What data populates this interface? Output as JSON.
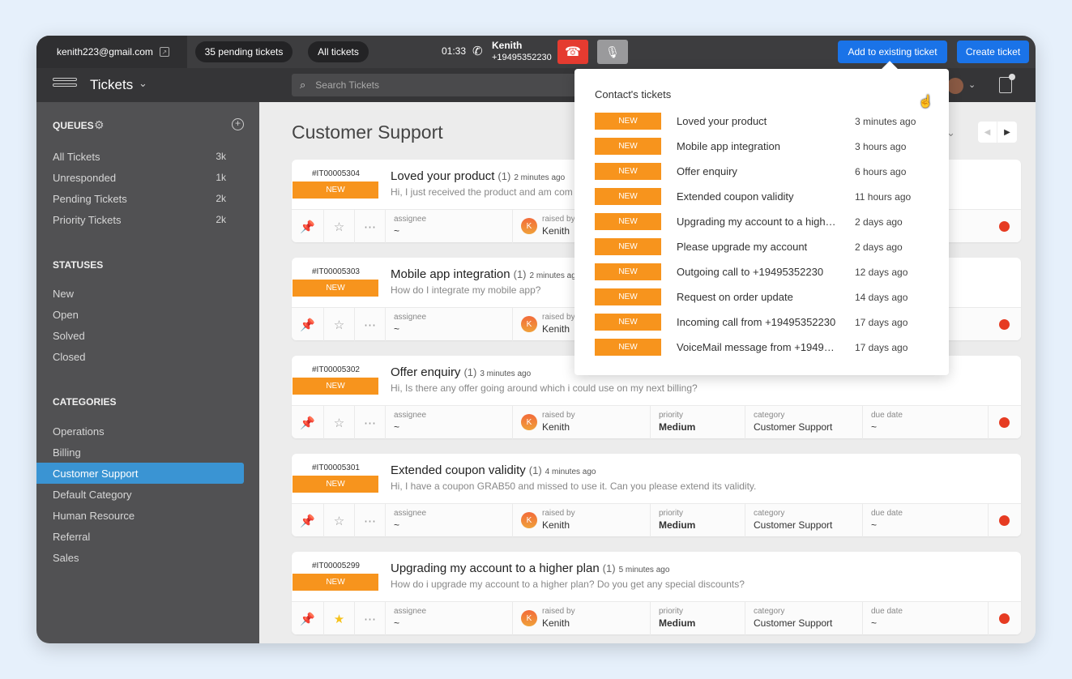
{
  "topbar": {
    "email": "kenith223@gmail.com",
    "pending_label": "35 pending tickets",
    "all_label": "All tickets",
    "call_time": "01:33",
    "caller_name": "Kenith",
    "caller_number": "+19495352230",
    "add_existing_label": "Add to existing ticket",
    "create_label": "Create ticket"
  },
  "header": {
    "app_name": "Tickets",
    "search_placeholder": "Search Tickets"
  },
  "sidebar": {
    "queues_heading": "QUEUES",
    "queues": [
      {
        "label": "All Tickets",
        "count": "3k"
      },
      {
        "label": "Unresponded",
        "count": "1k"
      },
      {
        "label": "Pending Tickets",
        "count": "2k"
      },
      {
        "label": "Priority Tickets",
        "count": "2k"
      }
    ],
    "statuses_heading": "STATUSES",
    "statuses": [
      "New",
      "Open",
      "Solved",
      "Closed"
    ],
    "categories_heading": "CATEGORIES",
    "categories": [
      "Operations",
      "Billing",
      "Customer Support",
      "Default Category",
      "Human Resource",
      "Referral",
      "Sales"
    ],
    "active_category": "Customer Support"
  },
  "main": {
    "title": "Customer Support",
    "pager_fragment": ")"
  },
  "tickets": [
    {
      "id": "#IT00005304",
      "status": "NEW",
      "title": "Loved your product",
      "count": "(1)",
      "time": "2 minutes ago",
      "desc": "Hi, I just received the product and am com",
      "assignee_label": "assignee",
      "assignee": "~",
      "raised_label": "raised by",
      "raised_by": "Kenith",
      "avatar_initial": "K",
      "priority_label": "",
      "priority": "",
      "category_label": "",
      "category": "",
      "due_label": "",
      "due": "",
      "starred": false
    },
    {
      "id": "#IT00005303",
      "status": "NEW",
      "title": "Mobile app integration",
      "count": "(1)",
      "time": "2 minutes ago",
      "desc": "How do I integrate my mobile app?",
      "assignee_label": "assignee",
      "assignee": "~",
      "raised_label": "raised by",
      "raised_by": "Kenith",
      "avatar_initial": "K",
      "priority_label": "",
      "priority": "",
      "category_label": "",
      "category": "",
      "due_label": "",
      "due": "",
      "starred": false
    },
    {
      "id": "#IT00005302",
      "status": "NEW",
      "title": "Offer enquiry",
      "count": "(1)",
      "time": "3 minutes ago",
      "desc": "Hi, Is there any offer going around which i could use on my next billing?",
      "assignee_label": "assignee",
      "assignee": "~",
      "raised_label": "raised by",
      "raised_by": "Kenith",
      "avatar_initial": "K",
      "priority_label": "priority",
      "priority": "Medium",
      "category_label": "category",
      "category": "Customer Support",
      "due_label": "due date",
      "due": "~",
      "starred": false
    },
    {
      "id": "#IT00005301",
      "status": "NEW",
      "title": "Extended coupon validity",
      "count": "(1)",
      "time": "4 minutes ago",
      "desc": "Hi, I have a coupon GRAB50 and missed to use it. Can you please extend its validity.",
      "assignee_label": "assignee",
      "assignee": "~",
      "raised_label": "raised by",
      "raised_by": "Kenith",
      "avatar_initial": "K",
      "priority_label": "priority",
      "priority": "Medium",
      "category_label": "category",
      "category": "Customer Support",
      "due_label": "due date",
      "due": "~",
      "starred": false
    },
    {
      "id": "#IT00005299",
      "status": "NEW",
      "title": "Upgrading my account to a higher plan",
      "count": "(1)",
      "time": "5 minutes ago",
      "desc": "How do i upgrade my account to a higher plan? Do you get any special discounts?",
      "assignee_label": "assignee",
      "assignee": "~",
      "raised_label": "raised by",
      "raised_by": "Kenith",
      "avatar_initial": "K",
      "priority_label": "priority",
      "priority": "Medium",
      "category_label": "category",
      "category": "Customer Support",
      "due_label": "due date",
      "due": "~",
      "starred": true
    }
  ],
  "popup": {
    "title": "Contact's tickets",
    "rows": [
      {
        "status": "NEW",
        "title": "Loved your product",
        "time": "3 minutes ago"
      },
      {
        "status": "NEW",
        "title": "Mobile app integration",
        "time": "3 hours ago"
      },
      {
        "status": "NEW",
        "title": "Offer enquiry",
        "time": "6 hours ago"
      },
      {
        "status": "NEW",
        "title": "Extended coupon validity",
        "time": "11 hours ago"
      },
      {
        "status": "NEW",
        "title": "Upgrading my account to a high…",
        "time": "2 days ago"
      },
      {
        "status": "NEW",
        "title": "Please upgrade my account",
        "time": "2 days ago"
      },
      {
        "status": "NEW",
        "title": "Outgoing call to +19495352230",
        "time": "12 days ago"
      },
      {
        "status": "NEW",
        "title": "Request on order update",
        "time": "14 days ago"
      },
      {
        "status": "NEW",
        "title": "Incoming call from +19495352230",
        "time": "17 days ago"
      },
      {
        "status": "NEW",
        "title": "VoiceMail message from +19495…",
        "time": "17 days ago"
      }
    ]
  },
  "colors": {
    "accent_blue": "#1a73e8",
    "status_orange": "#f7941d",
    "active_sidebar": "#3a94d3",
    "hangup_red": "#e53b30",
    "priority_dot": "#e63b22"
  },
  "icons": {
    "menu": "menu-icon",
    "search": "search-icon",
    "gear": "gear-icon",
    "plus": "plus-circle-icon",
    "pin": "pin-icon",
    "star": "star-icon",
    "more": "more-icon",
    "phone": "phone-icon",
    "hangup": "hangup-icon",
    "mic": "mic-icon",
    "notes": "notes-icon",
    "external": "external-link-icon"
  }
}
